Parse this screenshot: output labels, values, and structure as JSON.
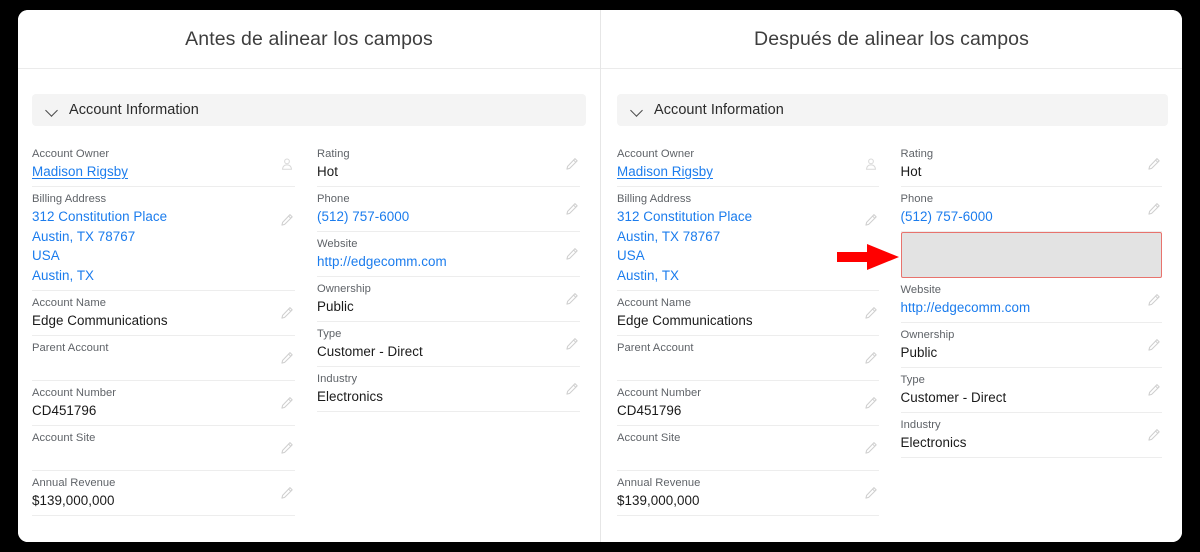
{
  "panels": [
    {
      "title": "Antes de alinear los campos",
      "section": {
        "label": "Account Information",
        "chevron_icon": "chevron-down-icon"
      },
      "left_column": [
        {
          "label": "Account Owner",
          "value": "Madison Rigsby",
          "style": "link-underline",
          "icon": "user-icon"
        },
        {
          "label": "Billing Address",
          "value": "312 Constitution Place\nAustin, TX 78767\nUSA\nAustin, TX",
          "style": "link",
          "icon": "pencil-icon"
        },
        {
          "label": "Account Name",
          "value": "Edge Communications",
          "style": "text",
          "icon": "pencil-icon"
        },
        {
          "label": "Parent Account",
          "value": "",
          "style": "text",
          "icon": "pencil-icon"
        },
        {
          "label": "Account Number",
          "value": "CD451796",
          "style": "text",
          "icon": "pencil-icon"
        },
        {
          "label": "Account Site",
          "value": "",
          "style": "text",
          "icon": "pencil-icon"
        },
        {
          "label": "Annual Revenue",
          "value": "$139,000,000",
          "style": "text",
          "icon": "pencil-icon"
        }
      ],
      "right_column": [
        {
          "label": "Rating",
          "value": "Hot",
          "style": "text",
          "icon": "pencil-icon"
        },
        {
          "label": "Phone",
          "value": "(512) 757-6000",
          "style": "link",
          "icon": "pencil-icon"
        },
        {
          "label": "Website",
          "value": "http://edgecomm.com",
          "style": "link",
          "icon": "pencil-icon"
        },
        {
          "label": "Ownership",
          "value": "Public",
          "style": "text",
          "icon": "pencil-icon"
        },
        {
          "label": "Type",
          "value": "Customer - Direct",
          "style": "text",
          "icon": "pencil-icon"
        },
        {
          "label": "Industry",
          "value": "Electronics",
          "style": "text",
          "icon": "pencil-icon"
        }
      ]
    },
    {
      "title": "Después de alinear los campos",
      "section": {
        "label": "Account Information",
        "chevron_icon": "chevron-down-icon"
      },
      "left_column": [
        {
          "label": "Account Owner",
          "value": "Madison Rigsby",
          "style": "link-underline",
          "icon": "user-icon"
        },
        {
          "label": "Billing Address",
          "value": "312 Constitution Place\nAustin, TX 78767\nUSA\nAustin, TX",
          "style": "link",
          "icon": "pencil-icon"
        },
        {
          "label": "Account Name",
          "value": "Edge Communications",
          "style": "text",
          "icon": "pencil-icon"
        },
        {
          "label": "Parent Account",
          "value": "",
          "style": "text",
          "icon": "pencil-icon"
        },
        {
          "label": "Account Number",
          "value": "CD451796",
          "style": "text",
          "icon": "pencil-icon"
        },
        {
          "label": "Account Site",
          "value": "",
          "style": "text",
          "icon": "pencil-icon"
        },
        {
          "label": "Annual Revenue",
          "value": "$139,000,000",
          "style": "text",
          "icon": "pencil-icon"
        }
      ],
      "right_column": [
        {
          "label": "Rating",
          "value": "Hot",
          "style": "text",
          "icon": "pencil-icon"
        },
        {
          "label": "Phone",
          "value": "(512) 757-6000",
          "style": "link",
          "icon": "pencil-icon"
        },
        {
          "label": "",
          "value": "",
          "style": "spacer",
          "icon": ""
        },
        {
          "label": "Website",
          "value": "http://edgecomm.com",
          "style": "link",
          "icon": "pencil-icon"
        },
        {
          "label": "Ownership",
          "value": "Public",
          "style": "text",
          "icon": "pencil-icon"
        },
        {
          "label": "Type",
          "value": "Customer - Direct",
          "style": "text",
          "icon": "pencil-icon"
        },
        {
          "label": "Industry",
          "value": "Electronics",
          "style": "text",
          "icon": "pencil-icon"
        }
      ]
    }
  ],
  "annotation": {
    "arrow_icon": "right-arrow-icon",
    "arrow_color": "#FF0000",
    "highlight_border_color": "#E8736D",
    "highlight_fill_color": "#E3E3E3"
  },
  "colors": {
    "link": "#1B7CED",
    "label": "#5F6368",
    "value": "#1A1A1A",
    "section_bar": "#F4F4F4",
    "page_background": "#000000",
    "card_background": "#FFFFFF"
  }
}
